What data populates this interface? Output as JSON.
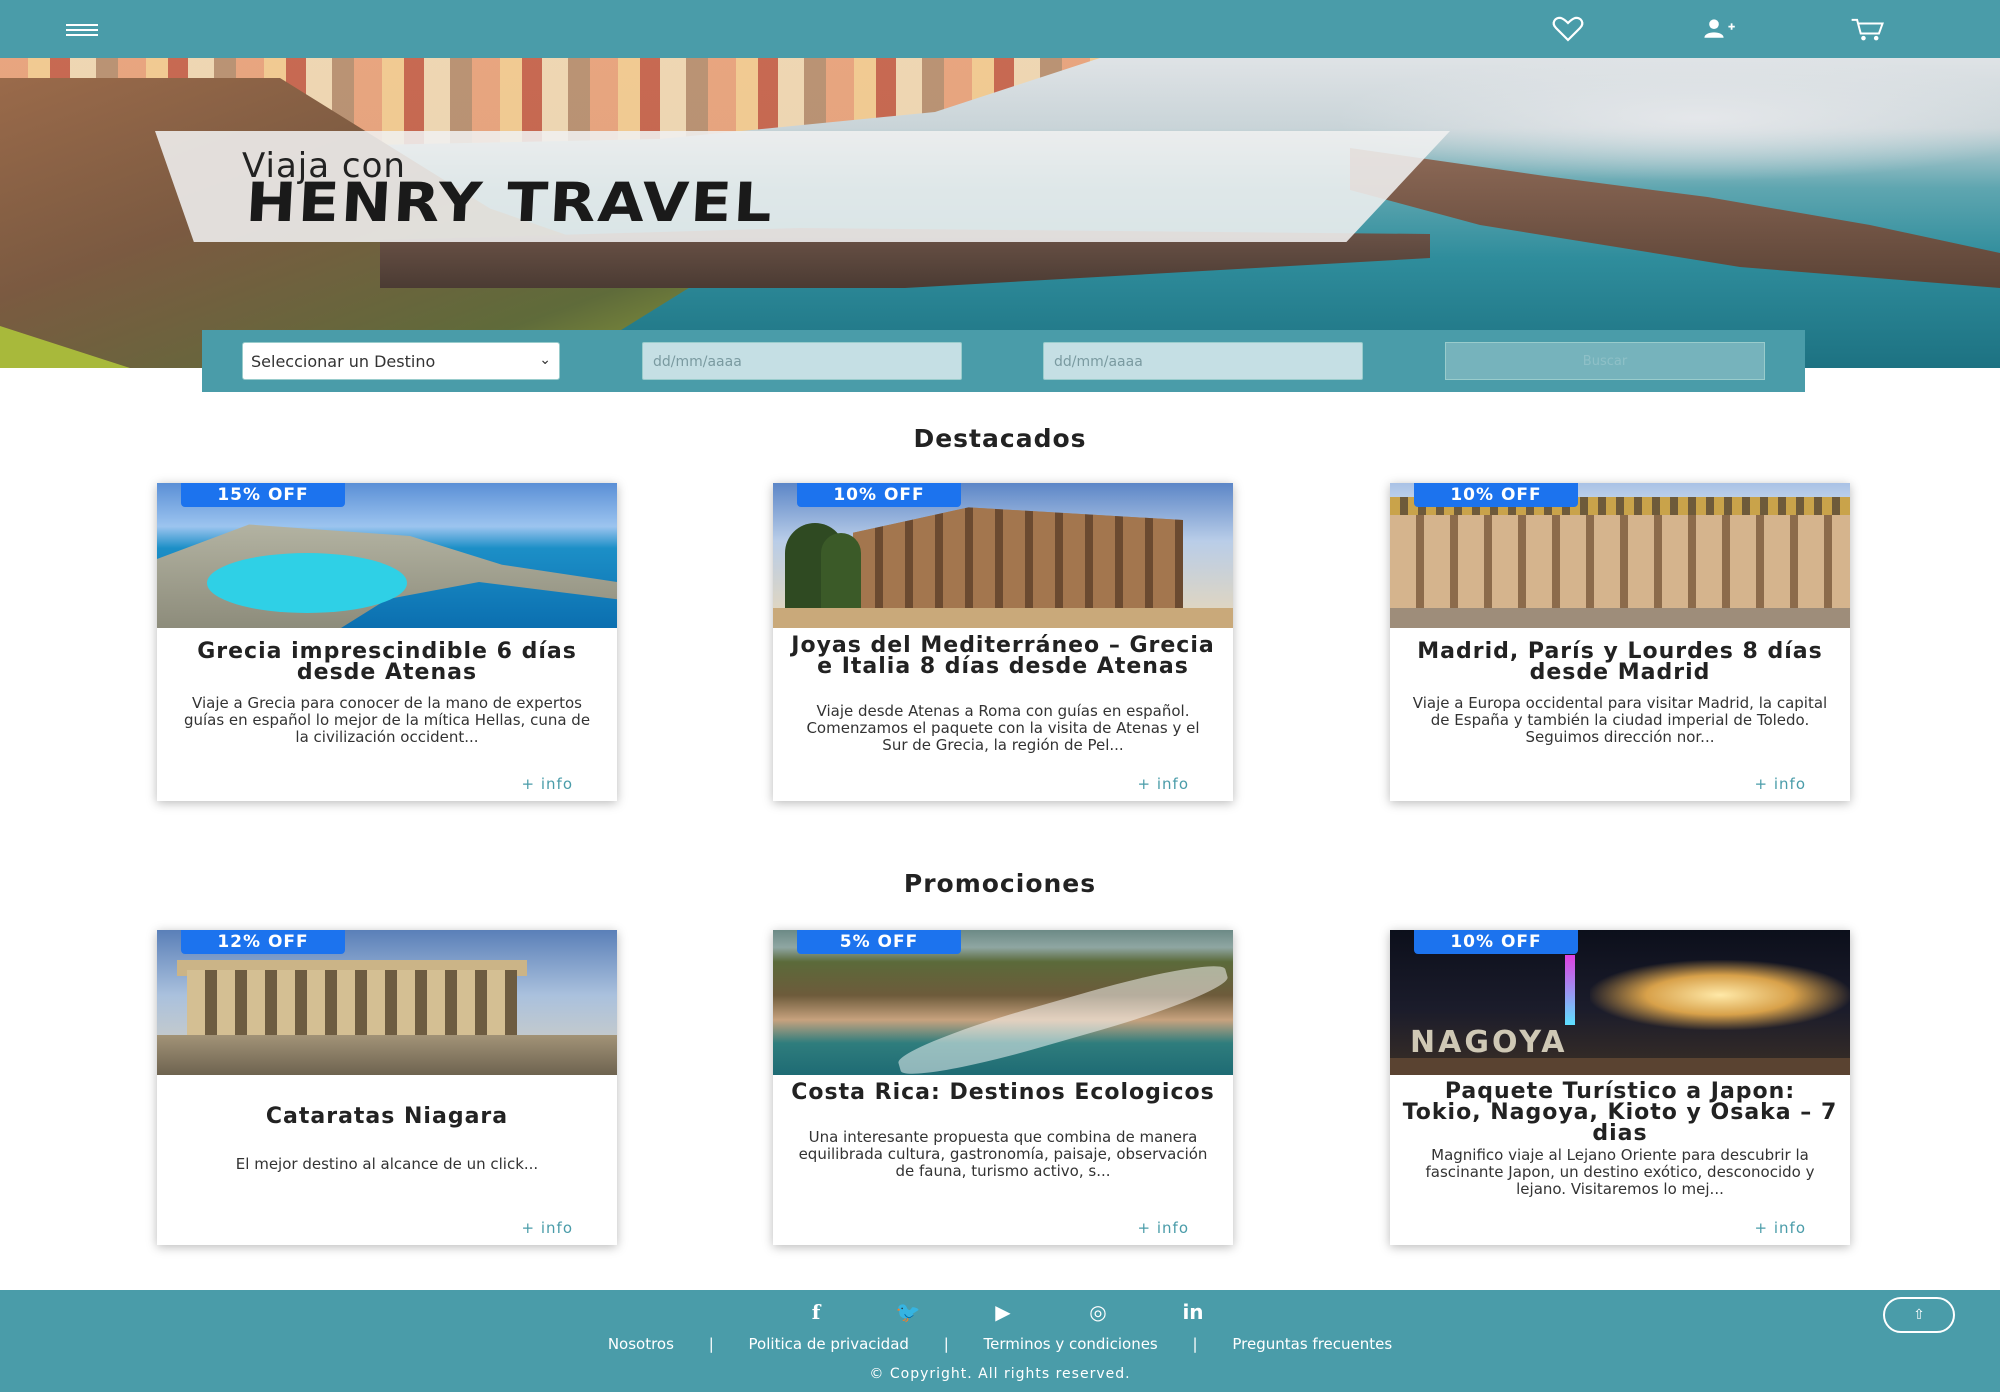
{
  "navbar": {
    "menu_icon": "hamburger-menu-icon",
    "favorites_icon": "heart-icon",
    "user_icon": "add-user-icon",
    "cart_icon": "shopping-cart-icon",
    "background": "#4a9ca9"
  },
  "hero": {
    "tagline_small": "Viaja con",
    "tagline_big": "HENRY TRAVEL"
  },
  "search": {
    "destination_selected": "Seleccionar un Destino",
    "date_from_placeholder": "dd/mm/aaaa",
    "date_to_placeholder": "dd/mm/aaaa",
    "button_label": "Buscar"
  },
  "sections": {
    "featured_title": "Destacados",
    "promos_title": "Promociones"
  },
  "featured": [
    {
      "badge": "15% OFF",
      "title": "Grecia imprescindible 6 días desde Atenas",
      "desc": "Viaje a Grecia para conocer de la mano de expertos guías en español lo mejor de la mítica Hellas, cuna de la civilización occident...",
      "more": "+ info"
    },
    {
      "badge": "10% OFF",
      "title": "Joyas del Mediterráneo – Grecia e Italia 8 días desde Atenas",
      "desc": "Viaje desde Atenas a Roma con guías en español. Comenzamos el paquete con la visita de Atenas y el Sur de Grecia, la región de Pel...",
      "more": "+ info"
    },
    {
      "badge": "10% OFF",
      "title": "Madrid, París y Lourdes 8 días desde Madrid",
      "desc": "Viaje a Europa occidental para visitar Madrid, la capital de España y también la ciudad imperial de Toledo. Seguimos dirección nor...",
      "more": "+ info"
    }
  ],
  "promos": [
    {
      "badge": "12% OFF",
      "title": "Cataratas Niagara",
      "desc": "El mejor destino al alcance de un click...",
      "more": "+ info"
    },
    {
      "badge": "5% OFF",
      "title": "Costa Rica: Destinos Ecologicos",
      "desc": "Una interesante propuesta que combina de manera equilibrada cultura, gastronomía, paisaje, observación de fauna, turismo activo, s...",
      "more": "+ info"
    },
    {
      "badge": "10% OFF",
      "title": "Paquete Turístico a Japon: Tokio, Nagoya, Kioto y Osaka – 7 dias",
      "desc": "Magnifico viaje al Lejano Oriente para descubrir la fascinante Japon, un destino exótico, desconocido y lejano. Visitaremos lo mej...",
      "more": "+ info",
      "image_sign": "NAGOYA"
    }
  ],
  "footer": {
    "social": {
      "facebook": "f",
      "twitter": "🐦",
      "youtube": "▶",
      "instagram": "◎",
      "linkedin": "in"
    },
    "links": [
      "Nosotros",
      "Politica de privacidad",
      "Terminos y condiciones",
      "Preguntas frecuentes"
    ],
    "separator": "|",
    "copyright": "© Copyright. All rights reserved.",
    "to_top_icon": "arrow-up-icon",
    "to_top_glyph": "⇧"
  }
}
